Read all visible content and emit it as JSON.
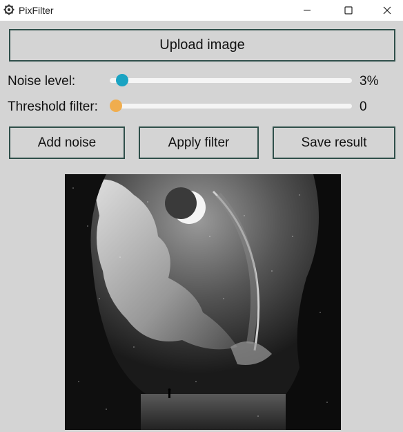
{
  "window": {
    "title": "PixFilter",
    "app_icon": "gear-icon",
    "controls": [
      "minimize-icon",
      "maximize-icon",
      "close-icon"
    ]
  },
  "buttons": {
    "upload": "Upload image",
    "add_noise": "Add noise",
    "apply_filter": "Apply filter",
    "save_result": "Save result"
  },
  "sliders": {
    "noise": {
      "label": "Noise level:",
      "value_text": "3%",
      "fraction": 0.05,
      "color": "#1aa3c2"
    },
    "threshold": {
      "label": "Threshold filter:",
      "value_text": "0",
      "fraction": 0.025,
      "color": "#f0ad4e"
    }
  },
  "image": {
    "description_name": "grayscale-night-landscape-image"
  }
}
